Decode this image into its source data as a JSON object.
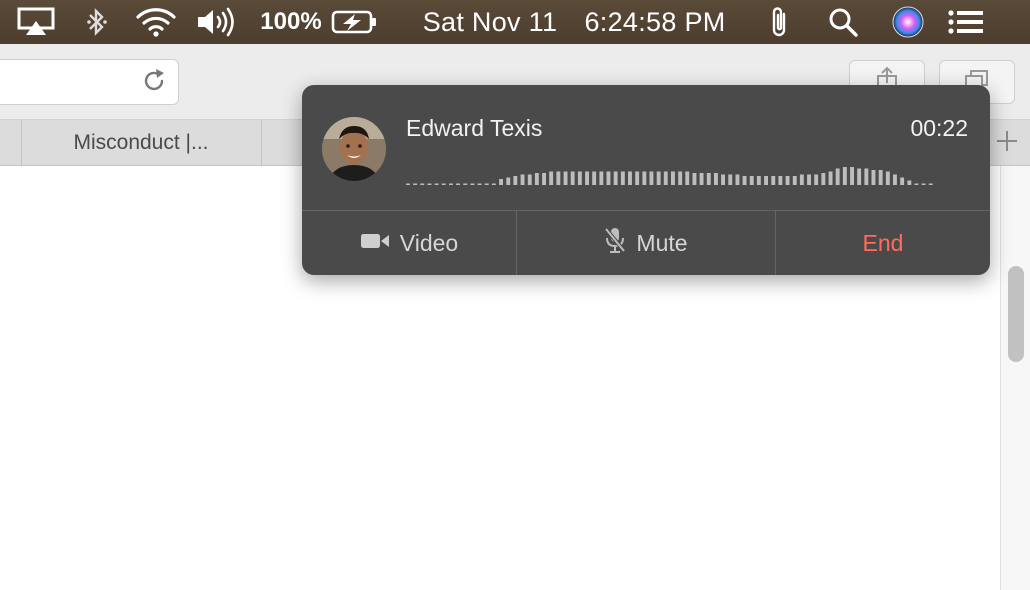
{
  "menubar": {
    "battery_percent": "100%",
    "date": "Sat Nov 11",
    "time": "6:24:58 PM"
  },
  "tabs": [
    {
      "label": "Misconduct |..."
    }
  ],
  "call": {
    "caller_name": "Edward Texis",
    "duration": "00:22",
    "video_label": "Video",
    "mute_label": "Mute",
    "end_label": "End",
    "colors": {
      "panel": "#4a4a4a",
      "end": "#ff6b5f"
    },
    "waveform_levels": [
      0.05,
      0.05,
      0.05,
      0.05,
      0.05,
      0.05,
      0.05,
      0.05,
      0.05,
      0.05,
      0.05,
      0.05,
      0.05,
      0.2,
      0.25,
      0.3,
      0.35,
      0.35,
      0.4,
      0.4,
      0.45,
      0.45,
      0.45,
      0.45,
      0.45,
      0.45,
      0.45,
      0.45,
      0.45,
      0.45,
      0.45,
      0.45,
      0.45,
      0.45,
      0.45,
      0.45,
      0.45,
      0.45,
      0.45,
      0.45,
      0.4,
      0.4,
      0.4,
      0.4,
      0.35,
      0.35,
      0.35,
      0.3,
      0.3,
      0.3,
      0.3,
      0.3,
      0.3,
      0.3,
      0.3,
      0.35,
      0.35,
      0.35,
      0.4,
      0.45,
      0.55,
      0.6,
      0.6,
      0.55,
      0.55,
      0.5,
      0.5,
      0.45,
      0.35,
      0.25,
      0.15,
      0.05,
      0.05,
      0.05
    ]
  },
  "icons": {
    "menubar": [
      "airplay-icon",
      "bluetooth-icon",
      "wifi-icon",
      "volume-icon",
      "battery-charging-icon",
      "paperclip-icon",
      "spotlight-search-icon",
      "siri-icon",
      "notification-center-icon"
    ],
    "toolbar": [
      "reload-icon",
      "share-icon",
      "tabs-overview-icon",
      "new-tab-plus-icon"
    ],
    "call": [
      "video-camera-icon",
      "microphone-muted-icon"
    ]
  }
}
